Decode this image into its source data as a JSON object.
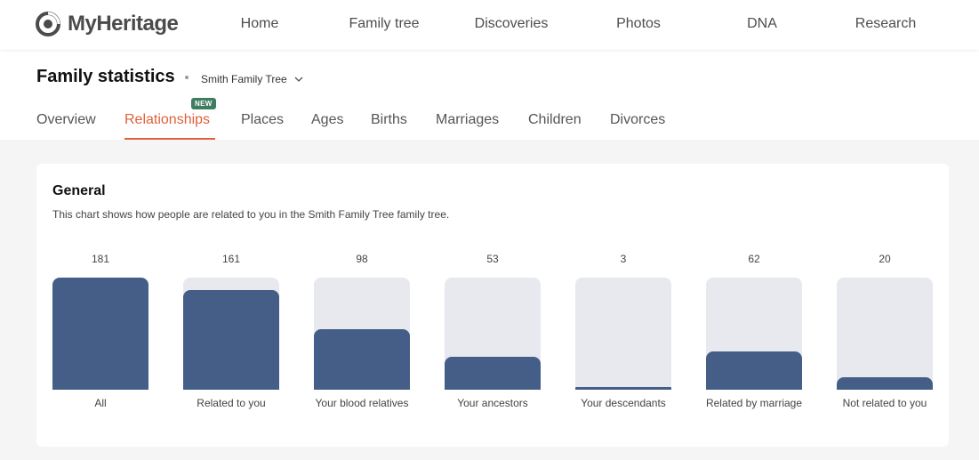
{
  "brand": {
    "name": "MyHeritage"
  },
  "nav": {
    "items": [
      {
        "label": "Home"
      },
      {
        "label": "Family tree"
      },
      {
        "label": "Discoveries"
      },
      {
        "label": "Photos"
      },
      {
        "label": "DNA"
      },
      {
        "label": "Research"
      }
    ]
  },
  "header": {
    "title": "Family statistics",
    "tree_name": "Smith Family Tree",
    "tabs": [
      {
        "label": "Overview",
        "active": false
      },
      {
        "label": "Relationships",
        "active": true,
        "badge": "NEW"
      },
      {
        "label": "Places",
        "active": false
      },
      {
        "label": "Ages",
        "active": false
      },
      {
        "label": "Births",
        "active": false
      },
      {
        "label": "Marriages",
        "active": false
      },
      {
        "label": "Children",
        "active": false
      },
      {
        "label": "Divorces",
        "active": false
      }
    ]
  },
  "colors": {
    "accent": "#e0603a",
    "bar_fill": "#445e87",
    "bar_track": "#e7e9ee",
    "badge": "#3f7d62"
  },
  "general": {
    "title": "General",
    "description": "This chart shows how people are related to you in the Smith Family Tree family tree.",
    "bars": [
      {
        "value": "181",
        "label": "All"
      },
      {
        "value": "161",
        "label": "Related to you"
      },
      {
        "value": "98",
        "label": "Your blood relatives"
      },
      {
        "value": "53",
        "label": "Your ancestors"
      },
      {
        "value": "3",
        "label": "Your descendants"
      },
      {
        "value": "62",
        "label": "Related by marriage"
      },
      {
        "value": "20",
        "label": "Not related to you"
      }
    ]
  }
}
